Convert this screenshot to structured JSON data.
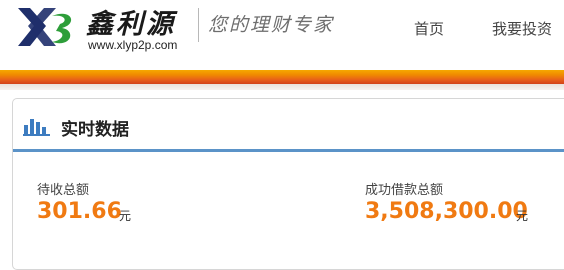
{
  "header": {
    "logo_letters": "XS",
    "brand_name": "鑫利源",
    "url": "www.xlyp2p.com",
    "tagline": "您的理财专家",
    "nav": [
      {
        "label": "首页"
      },
      {
        "label": "我要投资"
      }
    ]
  },
  "panel": {
    "icon": "bar-chart-icon",
    "title": "实时数据",
    "stats": [
      {
        "label": "待收总额",
        "value": "301.66",
        "unit": "元"
      },
      {
        "label": "成功借款总额",
        "value": "3,508,300.00",
        "unit": "元"
      }
    ]
  },
  "colors": {
    "brand_navy": "#1f2f6b",
    "brand_green": "#2e9e3a",
    "accent_orange": "#f07a12",
    "rule_blue": "#5b93c8"
  }
}
